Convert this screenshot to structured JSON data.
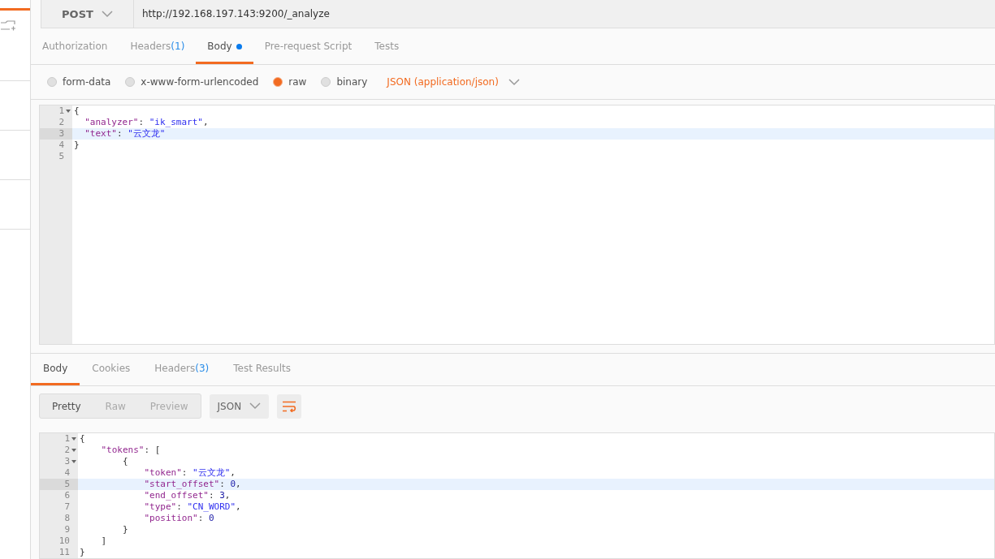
{
  "request": {
    "method": "POST",
    "url": "http://192.168.197.143:9200/_analyze"
  },
  "request_tabs": [
    {
      "label": "Authorization",
      "selected": false
    },
    {
      "label": "Headers",
      "count": "(1)",
      "selected": false
    },
    {
      "label": "Body",
      "dot": true,
      "selected": true
    },
    {
      "label": "Pre-request Script",
      "selected": false
    },
    {
      "label": "Tests",
      "selected": false
    }
  ],
  "body_types": [
    {
      "label": "form-data",
      "selected": false
    },
    {
      "label": "x-www-form-urlencoded",
      "selected": false
    },
    {
      "label": "raw",
      "selected": true
    },
    {
      "label": "binary",
      "selected": false
    }
  ],
  "content_type": "JSON (application/json)",
  "request_editor": [
    {
      "number": "1",
      "fold": true,
      "active": false,
      "parts": [
        {
          "kind": "punct",
          "text": "{"
        }
      ]
    },
    {
      "number": "2",
      "fold": false,
      "active": false,
      "parts": [
        {
          "kind": "key",
          "text": "  \"analyzer\""
        },
        {
          "kind": "punct",
          "text": ": "
        },
        {
          "kind": "string",
          "text": "\"ik_smart\""
        },
        {
          "kind": "punct",
          "text": ","
        }
      ]
    },
    {
      "number": "3",
      "fold": false,
      "active": true,
      "parts": [
        {
          "kind": "key",
          "text": "  \"text\""
        },
        {
          "kind": "punct",
          "text": ": "
        },
        {
          "kind": "string",
          "text": "\"云文龙\""
        }
      ]
    },
    {
      "number": "4",
      "fold": false,
      "active": false,
      "parts": [
        {
          "kind": "punct",
          "text": "}"
        }
      ]
    },
    {
      "number": "5",
      "fold": false,
      "active": false
    }
  ],
  "response_tabs": [
    {
      "label": "Body",
      "selected": true
    },
    {
      "label": "Cookies",
      "selected": false
    },
    {
      "label": "Headers",
      "count": "(3)",
      "selected": false
    },
    {
      "label": "Test Results",
      "selected": false
    }
  ],
  "view_modes": [
    {
      "label": "Pretty",
      "selected": true
    },
    {
      "label": "Raw",
      "selected": false
    },
    {
      "label": "Preview",
      "selected": false
    }
  ],
  "format": "JSON",
  "response_editor": [
    {
      "number": "1",
      "fold": true,
      "active": false,
      "parts": [
        {
          "kind": "punct",
          "text": "{"
        }
      ]
    },
    {
      "number": "2",
      "fold": true,
      "active": false,
      "parts": [
        {
          "kind": "key",
          "text": "    \"tokens\""
        },
        {
          "kind": "punct",
          "text": ": ["
        }
      ]
    },
    {
      "number": "3",
      "fold": true,
      "active": false,
      "parts": [
        {
          "kind": "punct",
          "text": "        {"
        }
      ]
    },
    {
      "number": "4",
      "fold": false,
      "active": false,
      "parts": [
        {
          "kind": "key",
          "text": "            \"token\""
        },
        {
          "kind": "punct",
          "text": ": "
        },
        {
          "kind": "string",
          "text": "\"云文龙\""
        },
        {
          "kind": "punct",
          "text": ","
        }
      ]
    },
    {
      "number": "5",
      "fold": false,
      "active": true,
      "parts": [
        {
          "kind": "key",
          "text": "            \"start_offset\""
        },
        {
          "kind": "punct",
          "text": ": "
        },
        {
          "kind": "number",
          "text": "0"
        },
        {
          "kind": "punct",
          "text": ","
        }
      ]
    },
    {
      "number": "6",
      "fold": false,
      "active": false,
      "parts": [
        {
          "kind": "key",
          "text": "            \"end_offset\""
        },
        {
          "kind": "punct",
          "text": ": "
        },
        {
          "kind": "number",
          "text": "3"
        },
        {
          "kind": "punct",
          "text": ","
        }
      ]
    },
    {
      "number": "7",
      "fold": false,
      "active": false,
      "parts": [
        {
          "kind": "key",
          "text": "            \"type\""
        },
        {
          "kind": "punct",
          "text": ": "
        },
        {
          "kind": "string",
          "text": "\"CN_WORD\""
        },
        {
          "kind": "punct",
          "text": ","
        }
      ]
    },
    {
      "number": "8",
      "fold": false,
      "active": false,
      "parts": [
        {
          "kind": "key",
          "text": "            \"position\""
        },
        {
          "kind": "punct",
          "text": ": "
        },
        {
          "kind": "number",
          "text": "0"
        }
      ]
    },
    {
      "number": "9",
      "fold": false,
      "active": false,
      "parts": [
        {
          "kind": "punct",
          "text": "        }"
        }
      ]
    },
    {
      "number": "10",
      "fold": false,
      "active": false,
      "parts": [
        {
          "kind": "punct",
          "text": "    ]"
        }
      ]
    },
    {
      "number": "11",
      "fold": false,
      "active": false,
      "parts": [
        {
          "kind": "punct",
          "text": "}"
        }
      ]
    }
  ]
}
